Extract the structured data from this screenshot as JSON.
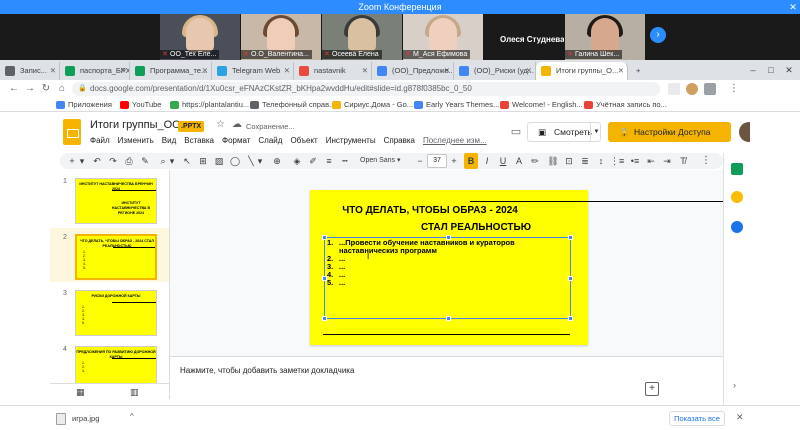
{
  "zoom": {
    "title": "Zoom Конференция",
    "participants": [
      {
        "name": "ОО_Тех Еле...",
        "muted": true,
        "skin": "#e8c7b0",
        "hair": "#d9b68a",
        "bg": "#4a4f5a"
      },
      {
        "name": "О.О_Валентина...",
        "muted": true,
        "skin": "#f0cdb8",
        "hair": "#6b4a32",
        "bg": "#c7b8a8"
      },
      {
        "name": "Осеева Елена",
        "muted": true,
        "skin": "#d8c0a0",
        "hair": "#3a3a3a",
        "bg": "#7a7f77"
      },
      {
        "name": "М_Ася Ефимова",
        "muted": true,
        "skin": "#efd0bf",
        "hair": "#c5a78a",
        "bg": "#d8d0c8"
      },
      {
        "name": "Олеся Студнева",
        "muted": false,
        "skin": "#1a1a1a",
        "hair": "#1a1a1a",
        "bg": "#1a1a1a"
      },
      {
        "name": "Галина Шек...",
        "muted": true,
        "skin": "#d6a98e",
        "hair": "#1f1a17",
        "bg": "#b7aea4"
      }
    ]
  },
  "browser": {
    "tabs": [
      {
        "label": "Запис...",
        "active": false,
        "color": "#5f6368"
      },
      {
        "label": "паспорта_БРХОВ",
        "active": false,
        "color": "#0f9d58"
      },
      {
        "label": "Программа_те...",
        "active": false,
        "color": "#0f9d58"
      },
      {
        "label": "Telegram Web",
        "active": false,
        "color": "#2aa3e0"
      },
      {
        "label": "nastavnik",
        "active": false,
        "color": "#e74c3c"
      },
      {
        "label": "(ОО)_Предложе...",
        "active": false,
        "color": "#4285f4"
      },
      {
        "label": "(ОО)_Риски (уд...",
        "active": false,
        "color": "#4285f4"
      },
      {
        "label": "Итоги группы_О...",
        "active": true,
        "color": "#f4b400"
      }
    ],
    "url": "docs.google.com/presentation/d/1Xu0csr_eFNAzCKstZR_bKHpa2wvddHu/edit#slide=id.g878f0385bc_0_50",
    "bookmarks": [
      {
        "label": "Приложения",
        "color": "#4285f4"
      },
      {
        "label": "YouTube",
        "color": "#ff0000"
      },
      {
        "label": "https://plantalantiu...",
        "color": "#34a853"
      },
      {
        "label": "Телефонный справ...",
        "color": "#5f6368"
      },
      {
        "label": "Сириус.Дома - Go...",
        "color": "#f4b400"
      },
      {
        "label": "Early Years Themes...",
        "color": "#4285f4"
      },
      {
        "label": "Welcome! - English...",
        "color": "#ea4335"
      },
      {
        "label": "Учётная запись по...",
        "color": "#ea4335"
      }
    ]
  },
  "doc": {
    "title": "Итоги группы_ОО",
    "badge": ".PPTX",
    "saving": "Сохранение...",
    "menus": [
      "Файл",
      "Изменить",
      "Вид",
      "Вставка",
      "Формат",
      "Слайд",
      "Объект",
      "Инструменты",
      "Справка"
    ],
    "last_change": "Последнее изм...",
    "present_label": "Смотреть",
    "share_label": "Настройки Доступа"
  },
  "toolbar": {
    "font": "Open Sans",
    "font_size": "37"
  },
  "slides": [
    {
      "num": "1",
      "title": "ИНСТИТУТ НАСТАВНИЧЕСТВА БРЕНЧИН 2024",
      "sub": "ИНСТИТУТ НАСТАВНИЧЕСТВА В РЕГИОНЕ 2024",
      "list": ""
    },
    {
      "num": "2",
      "title": "ЧТО ДЕЛАТЬ, ЧТОБЫ ОБРАЗ - 2024 СТАЛ РЕАЛЬНОСТЬЮ",
      "sub": "",
      "list": "1.\n2.\n3.\n4.\n5."
    },
    {
      "num": "3",
      "title": "РИСКИ ДОРОЖНОЙ КАРТЫ",
      "sub": "",
      "list": "1.\n2.\n3.\n4.\n5."
    },
    {
      "num": "4",
      "title": "ПРЕДЛОЖЕНИЯ ПО РАЗВИТИЮ ДОРОЖНОЙ КАРТЫ",
      "sub": "",
      "list": "1.\n2.\n3."
    }
  ],
  "current_slide": {
    "title_line1": "ЧТО ДЕЛАТЬ, ЧТОБЫ ОБРАЗ - 2024",
    "title_line2": "СТАЛ РЕАЛЬНОСТЬЮ",
    "bullets": [
      {
        "n": "1.",
        "text": "...Провести обучение наставников и кураторов наставническиз программ"
      },
      {
        "n": "2.",
        "text": "..."
      },
      {
        "n": "3.",
        "text": "..."
      },
      {
        "n": "4.",
        "text": "..."
      },
      {
        "n": "5.",
        "text": "..."
      }
    ]
  },
  "notes_placeholder": "Нажмите, чтобы добавить заметки докладчика",
  "downloads": {
    "file": "игра.jpg",
    "show_all": "Показать все"
  },
  "colors": {
    "slides_yellow": "#f4b400",
    "slide_bg": "#ffff00",
    "zoom_blue": "#2d8cff"
  }
}
